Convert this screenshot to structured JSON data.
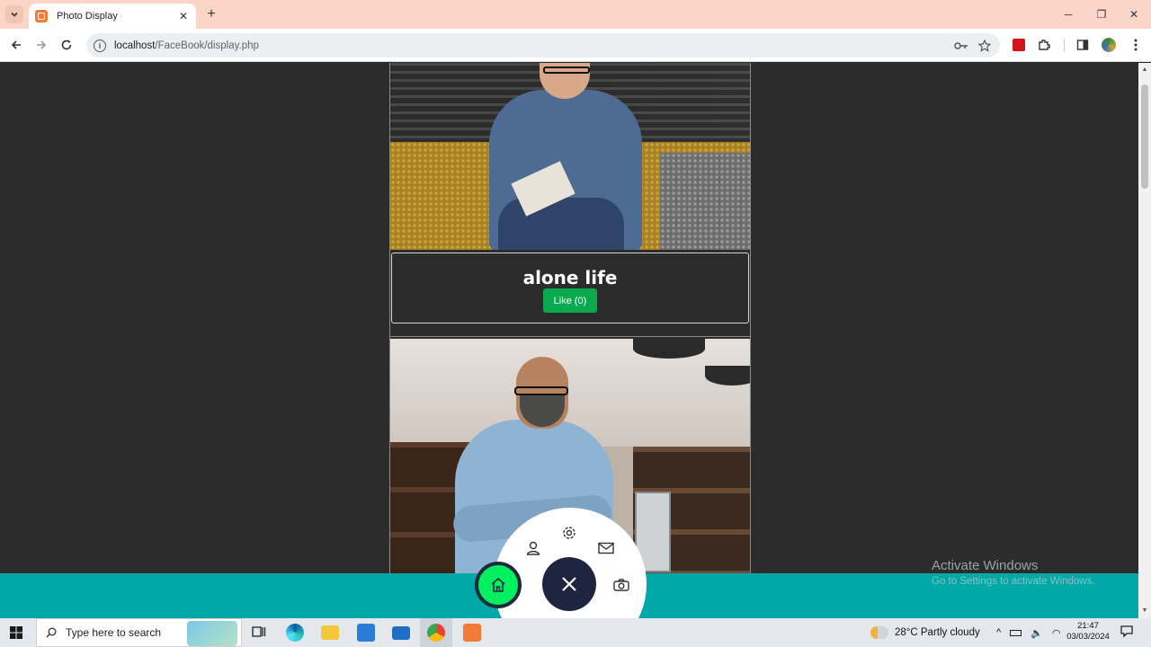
{
  "browser": {
    "tab_title": "Photo Display",
    "tab_close": "✕",
    "new_tab": "+",
    "url_host": "localhost",
    "url_path": "/FaceBook/display.php",
    "window_controls": {
      "minimize": "─",
      "maximize": "❐",
      "close": "✕"
    }
  },
  "page": {
    "posts": [
      {
        "caption": "alone life",
        "like_label": "Like (0)"
      },
      {
        "caption": "",
        "like_label": ""
      }
    ]
  },
  "fab": {
    "icons": [
      "home-icon",
      "user-icon",
      "settings-icon",
      "mail-icon",
      "camera-icon",
      "close-icon"
    ]
  },
  "watermark": {
    "title": "Activate Windows",
    "subtitle": "Go to Settings to activate Windows."
  },
  "taskbar": {
    "search_placeholder": "Type here to search",
    "weather": "28°C  Partly cloudy",
    "time": "21:47",
    "date": "03/03/2024"
  },
  "colors": {
    "tabstrip": "#fbd6c8",
    "page_bg": "#2c2c2c",
    "like_button": "#0aa84f",
    "bottom_bar": "#00a8a8",
    "home_fab": "#00f060",
    "close_fab": "#1f2540"
  }
}
